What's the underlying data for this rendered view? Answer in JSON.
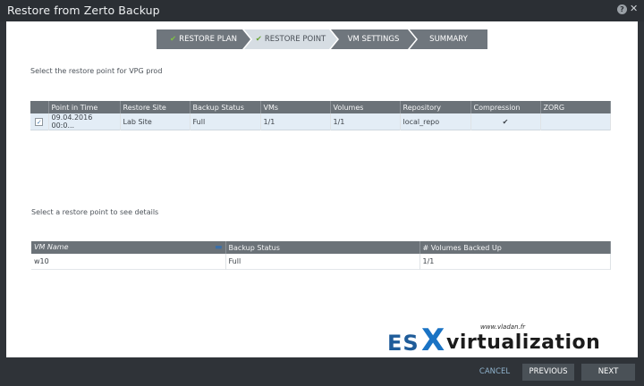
{
  "window": {
    "title": "Restore from Zerto Backup",
    "help_glyph": "?",
    "close_glyph": "✕"
  },
  "wizard": {
    "steps": [
      {
        "label": "RESTORE PLAN",
        "done": true
      },
      {
        "label": "RESTORE POINT",
        "done": true,
        "active": true
      },
      {
        "label": "VM SETTINGS",
        "done": false
      },
      {
        "label": "SUMMARY",
        "done": false
      }
    ],
    "check_glyph": "✔"
  },
  "restore_points": {
    "instruction": "Select the restore point for VPG prod",
    "columns": [
      "Point in Time",
      "Restore Site",
      "Backup Status",
      "VMs",
      "Volumes",
      "Repository",
      "Compression",
      "ZORG"
    ],
    "rows": [
      {
        "checked": true,
        "checkbox_glyph": "✓",
        "cells": [
          "09.04.2016 00:0...",
          "Lab Site",
          "Full",
          "1/1",
          "1/1",
          "local_repo",
          "✔",
          ""
        ]
      }
    ]
  },
  "details": {
    "instruction": "Select a restore point to see details",
    "columns": [
      "VM Name",
      "Backup Status",
      "# Volumes Backed Up"
    ],
    "sort_glyph": "▬",
    "rows": [
      {
        "cells": [
          "w10",
          "Full",
          "1/1"
        ]
      }
    ]
  },
  "watermark": {
    "site": "www.vladan.fr",
    "part1": "ES",
    "part2": "X",
    "part3": "virtualization"
  },
  "footer": {
    "cancel": "CANCEL",
    "previous": "PREVIOUS",
    "next": "NEXT"
  },
  "colors": {
    "accent": "#1a73c4",
    "header_bg": "#6b7278",
    "selected_row": "#e3edf6",
    "check_green": "#7fc241"
  }
}
